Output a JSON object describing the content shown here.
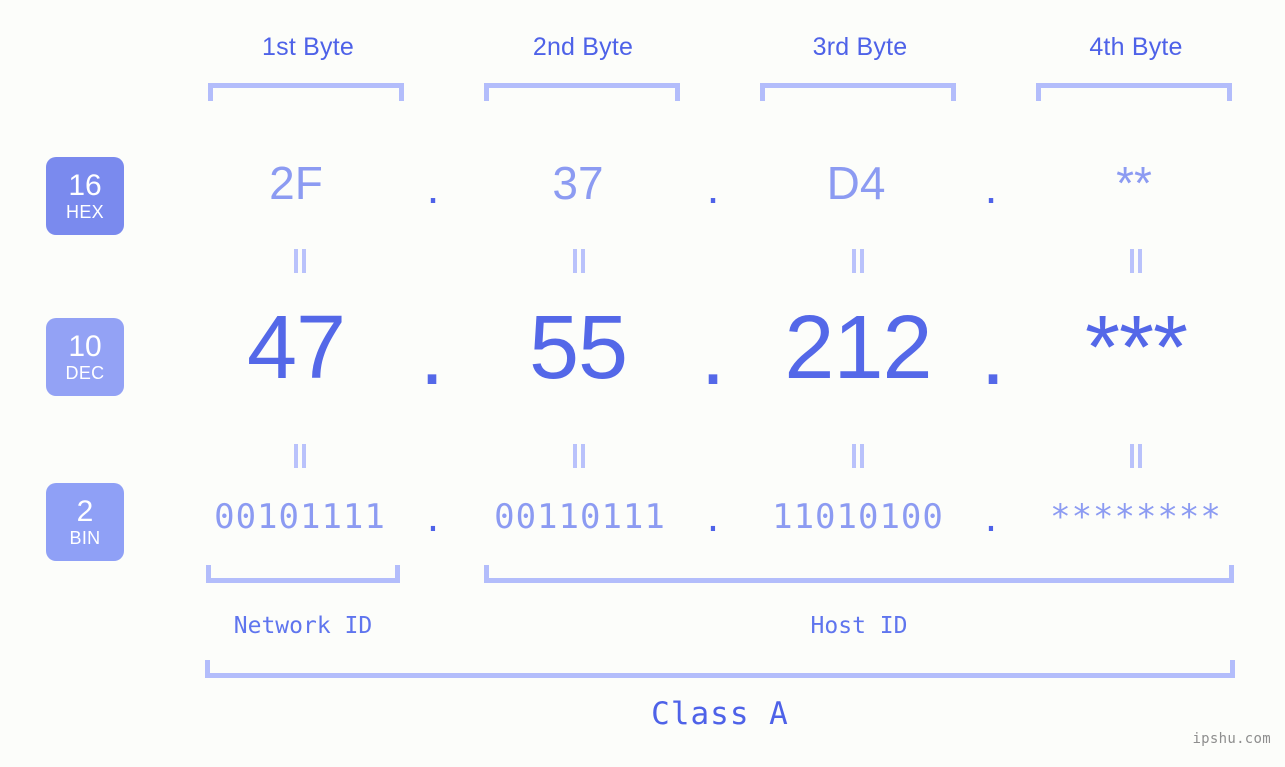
{
  "headers": [
    {
      "label": "1st Byte"
    },
    {
      "label": "2nd Byte"
    },
    {
      "label": "3rd Byte"
    },
    {
      "label": "4th Byte"
    }
  ],
  "bases": [
    {
      "num": "16",
      "abbr": "HEX"
    },
    {
      "num": "10",
      "abbr": "DEC"
    },
    {
      "num": "2",
      "abbr": "BIN"
    }
  ],
  "rows": {
    "hex": {
      "values": [
        "2F",
        "37",
        "D4",
        "**"
      ],
      "separator": "."
    },
    "dec": {
      "values": [
        "47",
        "55",
        "212",
        "***"
      ],
      "separator": "."
    },
    "bin": {
      "values": [
        "00101111",
        "00110111",
        "11010100",
        "********"
      ],
      "separator": "."
    }
  },
  "sections": [
    {
      "label": "Network ID"
    },
    {
      "label": "Host ID"
    }
  ],
  "class": {
    "label": "Class A"
  },
  "watermark": {
    "text": "ipshu.com"
  },
  "colors": {
    "background": "#fcfdfa",
    "accent_strong": "#4e62e8",
    "accent_mid": "#5468e8",
    "accent_light": "#8c9bf2",
    "bracket": "#b3bdfb",
    "badge_hex": "#7a8aee",
    "badge_dec": "#93a2f5",
    "badge_bin": "#8fa0f6",
    "watermark": "#8e8e8e"
  }
}
